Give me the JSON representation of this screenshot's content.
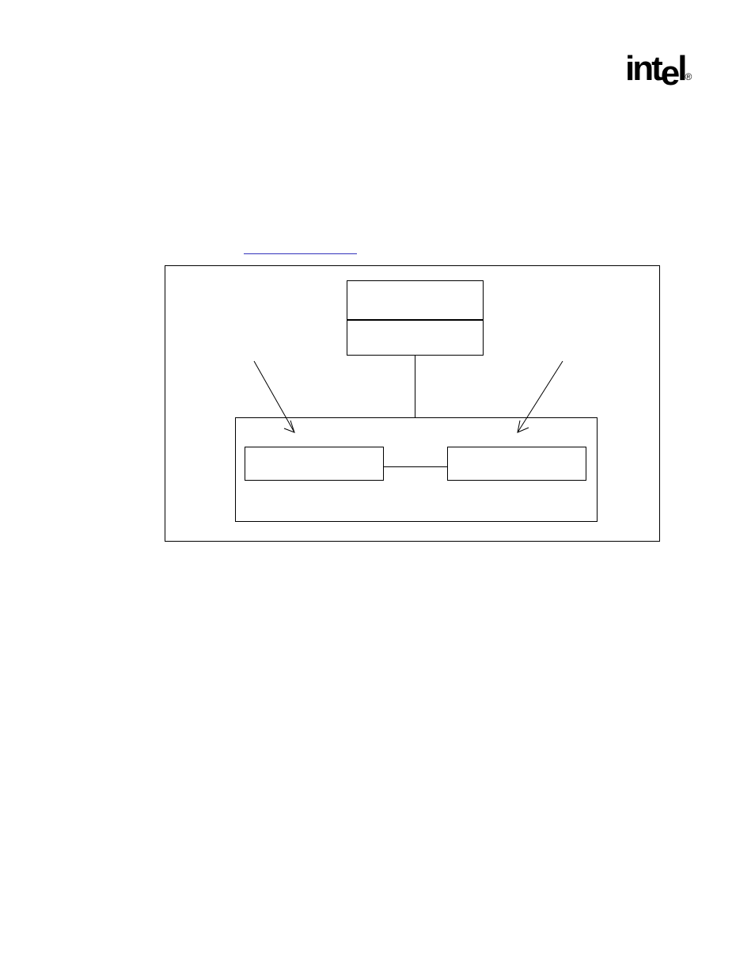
{
  "logo": {
    "text": "int",
    "e": "e",
    "l": "l",
    "reg": "®"
  }
}
